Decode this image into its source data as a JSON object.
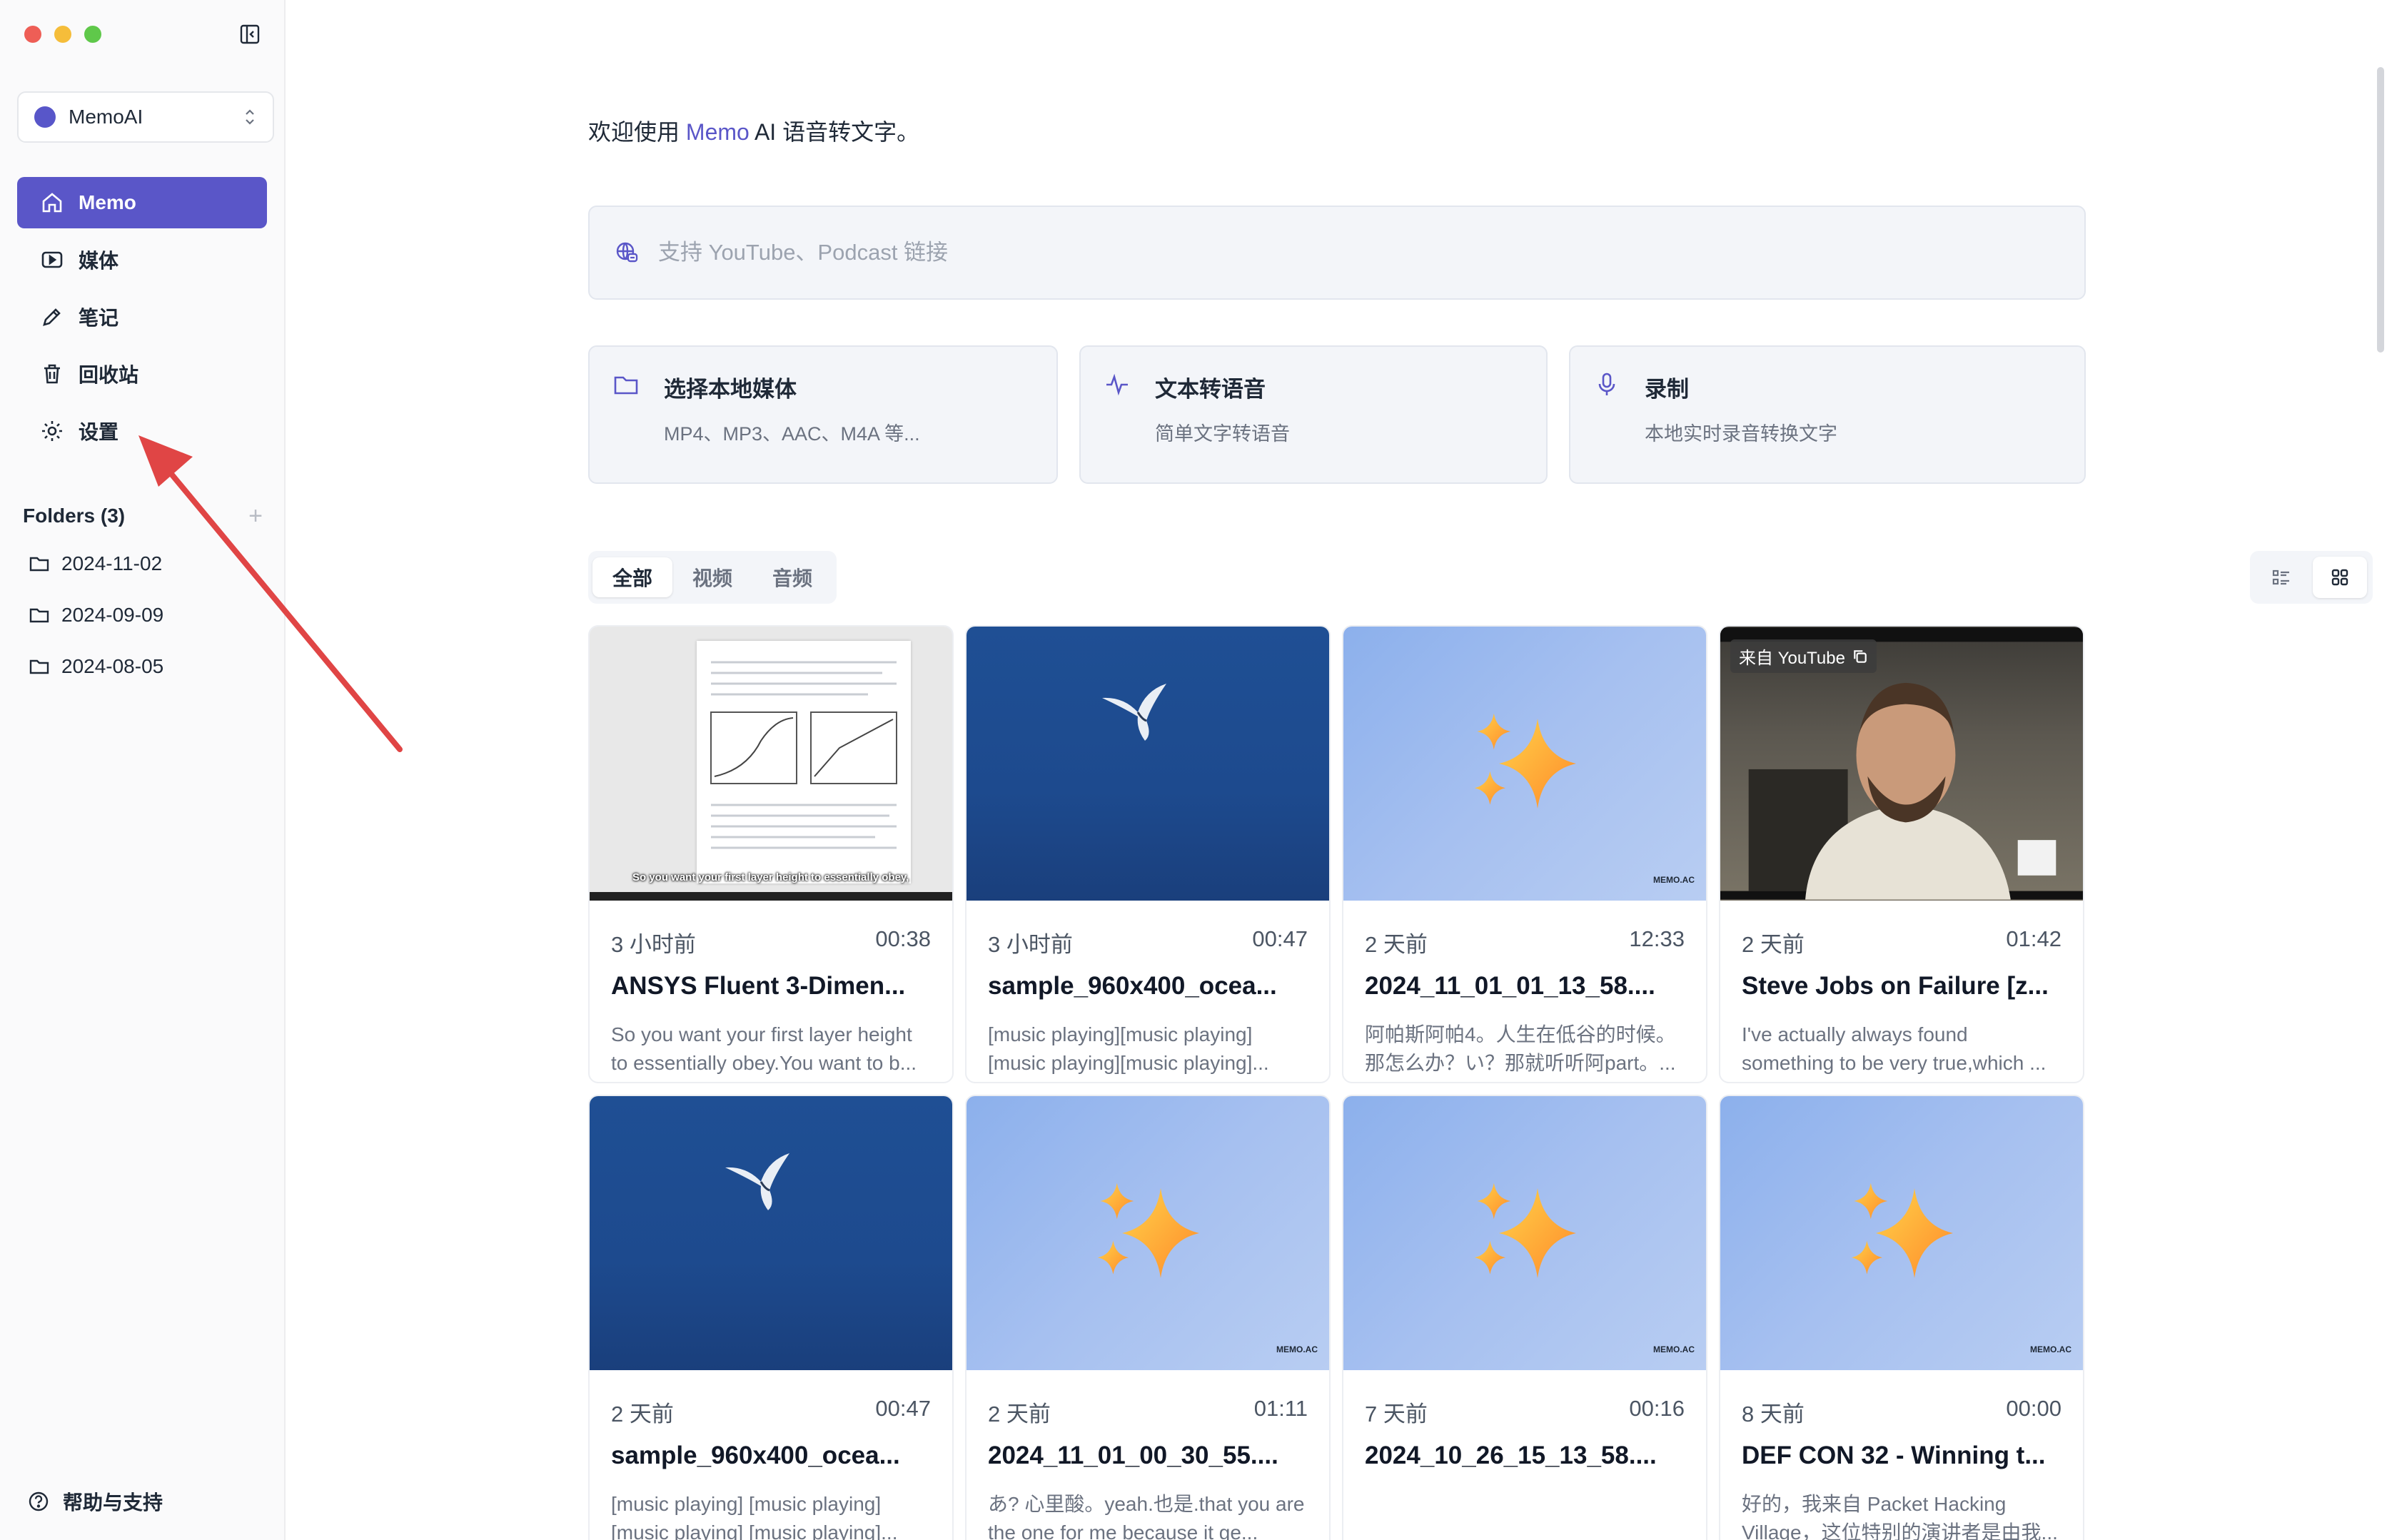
{
  "sidebar": {
    "workspace": "MemoAI",
    "nav": [
      {
        "label": "Memo",
        "icon": "home-icon"
      },
      {
        "label": "媒体",
        "icon": "play-icon"
      },
      {
        "label": "笔记",
        "icon": "pencil-icon"
      },
      {
        "label": "回收站",
        "icon": "trash-icon"
      },
      {
        "label": "设置",
        "icon": "gear-icon"
      }
    ],
    "folders_title": "Folders (3)",
    "folders_add": "+",
    "folders": [
      "2024-11-02",
      "2024-09-09",
      "2024-08-05"
    ],
    "help": "帮助与支持"
  },
  "main": {
    "welcome_prefix": "欢迎使用 ",
    "welcome_brand": "Memo",
    "welcome_suffix": " AI 语音转文字。",
    "link_placeholder": "支持 YouTube、Podcast 链接",
    "actions": [
      {
        "title": "选择本地媒体",
        "sub": "MP4、MP3、AAC、M4A 等...",
        "icon": "folder-icon"
      },
      {
        "title": "文本转语音",
        "sub": "简单文字转语音",
        "icon": "waveform-icon"
      },
      {
        "title": "录制",
        "sub": "本地实时录音转换文字",
        "icon": "microphone-icon"
      }
    ],
    "tabs": [
      "全部",
      "视频",
      "音频"
    ],
    "cards": [
      {
        "thumb": "doc",
        "ago": "3 小时前",
        "duration": "00:38",
        "title": "ANSYS Fluent 3-Dimen...",
        "desc": "So you want your first layer height to essentially obey.You want to b...",
        "caption": "So you want your first layer height to essentially obey,"
      },
      {
        "thumb": "ocean",
        "ago": "3 小时前",
        "duration": "00:47",
        "title": "sample_960x400_ocea...",
        "desc": "[music playing][music playing] [music playing][music playing]..."
      },
      {
        "thumb": "spark",
        "ago": "2 天前",
        "duration": "12:33",
        "title": "2024_11_01_01_13_58....",
        "desc": "阿帕斯阿帕4。人生在低谷的时候。那怎么办？い？那就听听阿part。...",
        "mark": "MEMO.AC"
      },
      {
        "thumb": "photo",
        "ago": "2 天前",
        "duration": "01:42",
        "title": "Steve Jobs on Failure [z...",
        "desc": "I've actually always found something to be very true,which ...",
        "badge": "来自 YouTube"
      },
      {
        "thumb": "ocean",
        "ago": "2 天前",
        "duration": "00:47",
        "title": "sample_960x400_ocea...",
        "desc": "[music playing] [music playing] [music playing] [music playing]..."
      },
      {
        "thumb": "spark",
        "ago": "2 天前",
        "duration": "01:11",
        "title": "2024_11_01_00_30_55....",
        "desc": "あ? 心里酸。yeah.也是.that you are the one for me because it ge...",
        "mark": "MEMO.AC"
      },
      {
        "thumb": "spark",
        "ago": "7 天前",
        "duration": "00:16",
        "title": "2024_10_26_15_13_58....",
        "desc": "",
        "mark": "MEMO.AC"
      },
      {
        "thumb": "spark",
        "ago": "8 天前",
        "duration": "00:00",
        "title": "DEF CON 32 - Winning t...",
        "desc": "好的，我来自 Packet Hacking Village，这位特别的演讲者是由我...",
        "mark": "MEMO.AC"
      }
    ]
  },
  "colors": {
    "accent": "#5a56c8",
    "arrow": "#e04545"
  }
}
